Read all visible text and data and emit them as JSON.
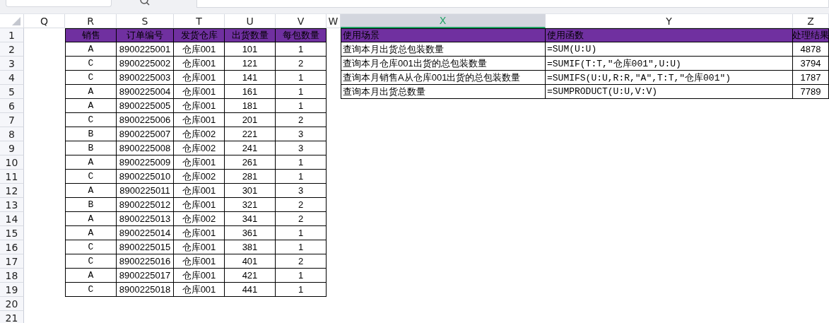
{
  "columns": [
    {
      "label": "Q",
      "selected": false
    },
    {
      "label": "R",
      "selected": false
    },
    {
      "label": "S",
      "selected": false
    },
    {
      "label": "T",
      "selected": false
    },
    {
      "label": "U",
      "selected": false
    },
    {
      "label": "V",
      "selected": false
    },
    {
      "label": "W",
      "selected": false
    },
    {
      "label": "X",
      "selected": true
    },
    {
      "label": "Y",
      "selected": false
    },
    {
      "label": "Z",
      "selected": false
    }
  ],
  "row_numbers": [
    "1",
    "2",
    "3",
    "4",
    "5",
    "6",
    "7",
    "8",
    "9",
    "10",
    "11",
    "12",
    "13",
    "14",
    "15",
    "16",
    "17",
    "18",
    "19",
    "20",
    "21"
  ],
  "orders_table": {
    "columns": [
      "销售",
      "订单编号",
      "发货仓库",
      "出货数量",
      "每包数量"
    ],
    "rows": [
      [
        "A",
        "8900225001",
        "仓库001",
        "101",
        "1"
      ],
      [
        "C",
        "8900225002",
        "仓库001",
        "121",
        "2"
      ],
      [
        "C",
        "8900225003",
        "仓库001",
        "141",
        "1"
      ],
      [
        "A",
        "8900225004",
        "仓库001",
        "161",
        "1"
      ],
      [
        "A",
        "8900225005",
        "仓库001",
        "181",
        "1"
      ],
      [
        "C",
        "8900225006",
        "仓库001",
        "201",
        "2"
      ],
      [
        "B",
        "8900225007",
        "仓库002",
        "221",
        "3"
      ],
      [
        "B",
        "8900225008",
        "仓库002",
        "241",
        "3"
      ],
      [
        "A",
        "8900225009",
        "仓库001",
        "261",
        "1"
      ],
      [
        "C",
        "8900225010",
        "仓库002",
        "281",
        "1"
      ],
      [
        "A",
        "8900225011",
        "仓库001",
        "301",
        "3"
      ],
      [
        "B",
        "8900225012",
        "仓库001",
        "321",
        "2"
      ],
      [
        "A",
        "8900225013",
        "仓库002",
        "341",
        "2"
      ],
      [
        "A",
        "8900225014",
        "仓库001",
        "361",
        "1"
      ],
      [
        "C",
        "8900225015",
        "仓库001",
        "381",
        "1"
      ],
      [
        "C",
        "8900225016",
        "仓库001",
        "401",
        "2"
      ],
      [
        "A",
        "8900225017",
        "仓库001",
        "421",
        "1"
      ],
      [
        "C",
        "8900225018",
        "仓库001",
        "441",
        "1"
      ]
    ]
  },
  "functions_table": {
    "columns": [
      "使用场景",
      "使用函数",
      "处理结果"
    ],
    "rows": [
      [
        "查询本月出货总包装数量",
        "=SUM(U:U)",
        "4878"
      ],
      [
        "查询本月仓库001出货的总包装数量",
        "=SUMIF(T:T,\"仓库001\",U:U)",
        "3794"
      ],
      [
        "查询本月销售A从仓库001出货的总包装数量",
        "=SUMIFS(U:U,R:R,\"A\",T:T,\"仓库001\")",
        "1787"
      ],
      [
        "查询本月出货总数量",
        "=SUMPRODUCT(U:U,V:V)",
        "7789"
      ]
    ]
  }
}
